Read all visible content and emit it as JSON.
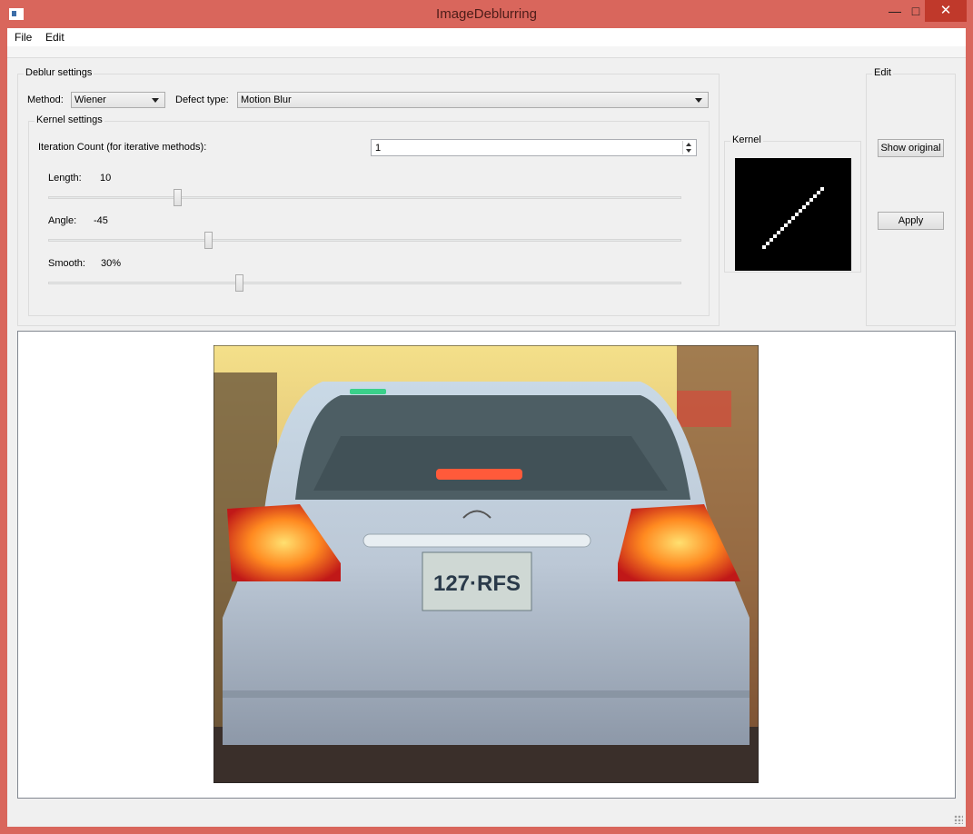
{
  "window": {
    "title": "ImageDeblurring"
  },
  "menu": {
    "file": "File",
    "edit": "Edit"
  },
  "deblur_settings": {
    "title": "Deblur settings",
    "method_label": "Method:",
    "method_value": "Wiener",
    "defect_label": "Defect type:",
    "defect_value": "Motion Blur"
  },
  "kernel_settings": {
    "title": "Kernel settings",
    "iteration_label": "Iteration Count (for iterative methods):",
    "iteration_value": "1",
    "length": {
      "label": "Length:",
      "value": "10",
      "level": 0.2
    },
    "angle": {
      "label": "Angle:",
      "value": "-45",
      "level": 0.25
    },
    "smooth": {
      "label": "Smooth:",
      "value": "30%",
      "level": 0.3
    }
  },
  "kernel": {
    "title": "Kernel"
  },
  "edit": {
    "title": "Edit",
    "show_original": "Show original",
    "apply": "Apply"
  },
  "icons": [
    "app-icon",
    "minimize-icon",
    "maximize-icon",
    "close-icon",
    "dropdown-arrow-icon",
    "spin-up-icon",
    "spin-down-icon",
    "resize-grip-icon"
  ]
}
